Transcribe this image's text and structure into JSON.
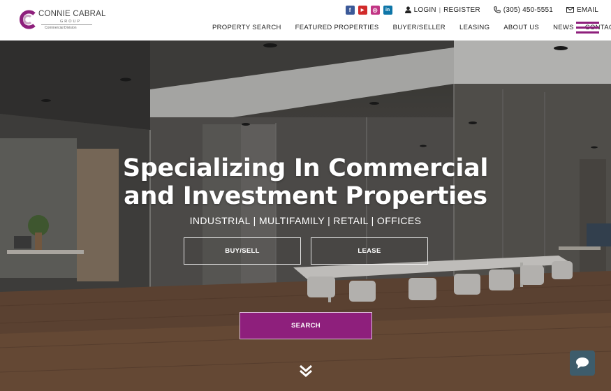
{
  "logo": {
    "name": "CONNIE CABRAL",
    "group": "GROUP",
    "division": "Commercial Division",
    "brand_color": "#8e1f7c"
  },
  "top_bar": {
    "social": [
      {
        "name": "facebook-icon",
        "glyph": "f"
      },
      {
        "name": "youtube-icon",
        "glyph": "▶"
      },
      {
        "name": "instagram-icon",
        "glyph": "◎"
      },
      {
        "name": "linkedin-icon",
        "glyph": "in"
      }
    ],
    "login_label": "LOGIN",
    "separator": "|",
    "register_label": "REGISTER",
    "phone": "(305) 450-5551",
    "email_label": "EMAIL"
  },
  "nav": {
    "items": [
      "PROPERTY SEARCH",
      "FEATURED PROPERTIES",
      "BUYER/SELLER",
      "LEASING",
      "ABOUT US",
      "NEWS",
      "CONTACT"
    ]
  },
  "hero": {
    "title_line1": "Specializing In Commercial",
    "title_line2": "and Investment Properties",
    "subtitle": "INDUSTRIAL | MULTIFAMILY | RETAIL | OFFICES",
    "buy_sell_label": "BUY/SELL",
    "lease_label": "LEASE",
    "search_label": "SEARCH"
  },
  "colors": {
    "accent": "#8e1f7c",
    "chat": "#3d5c6b"
  }
}
